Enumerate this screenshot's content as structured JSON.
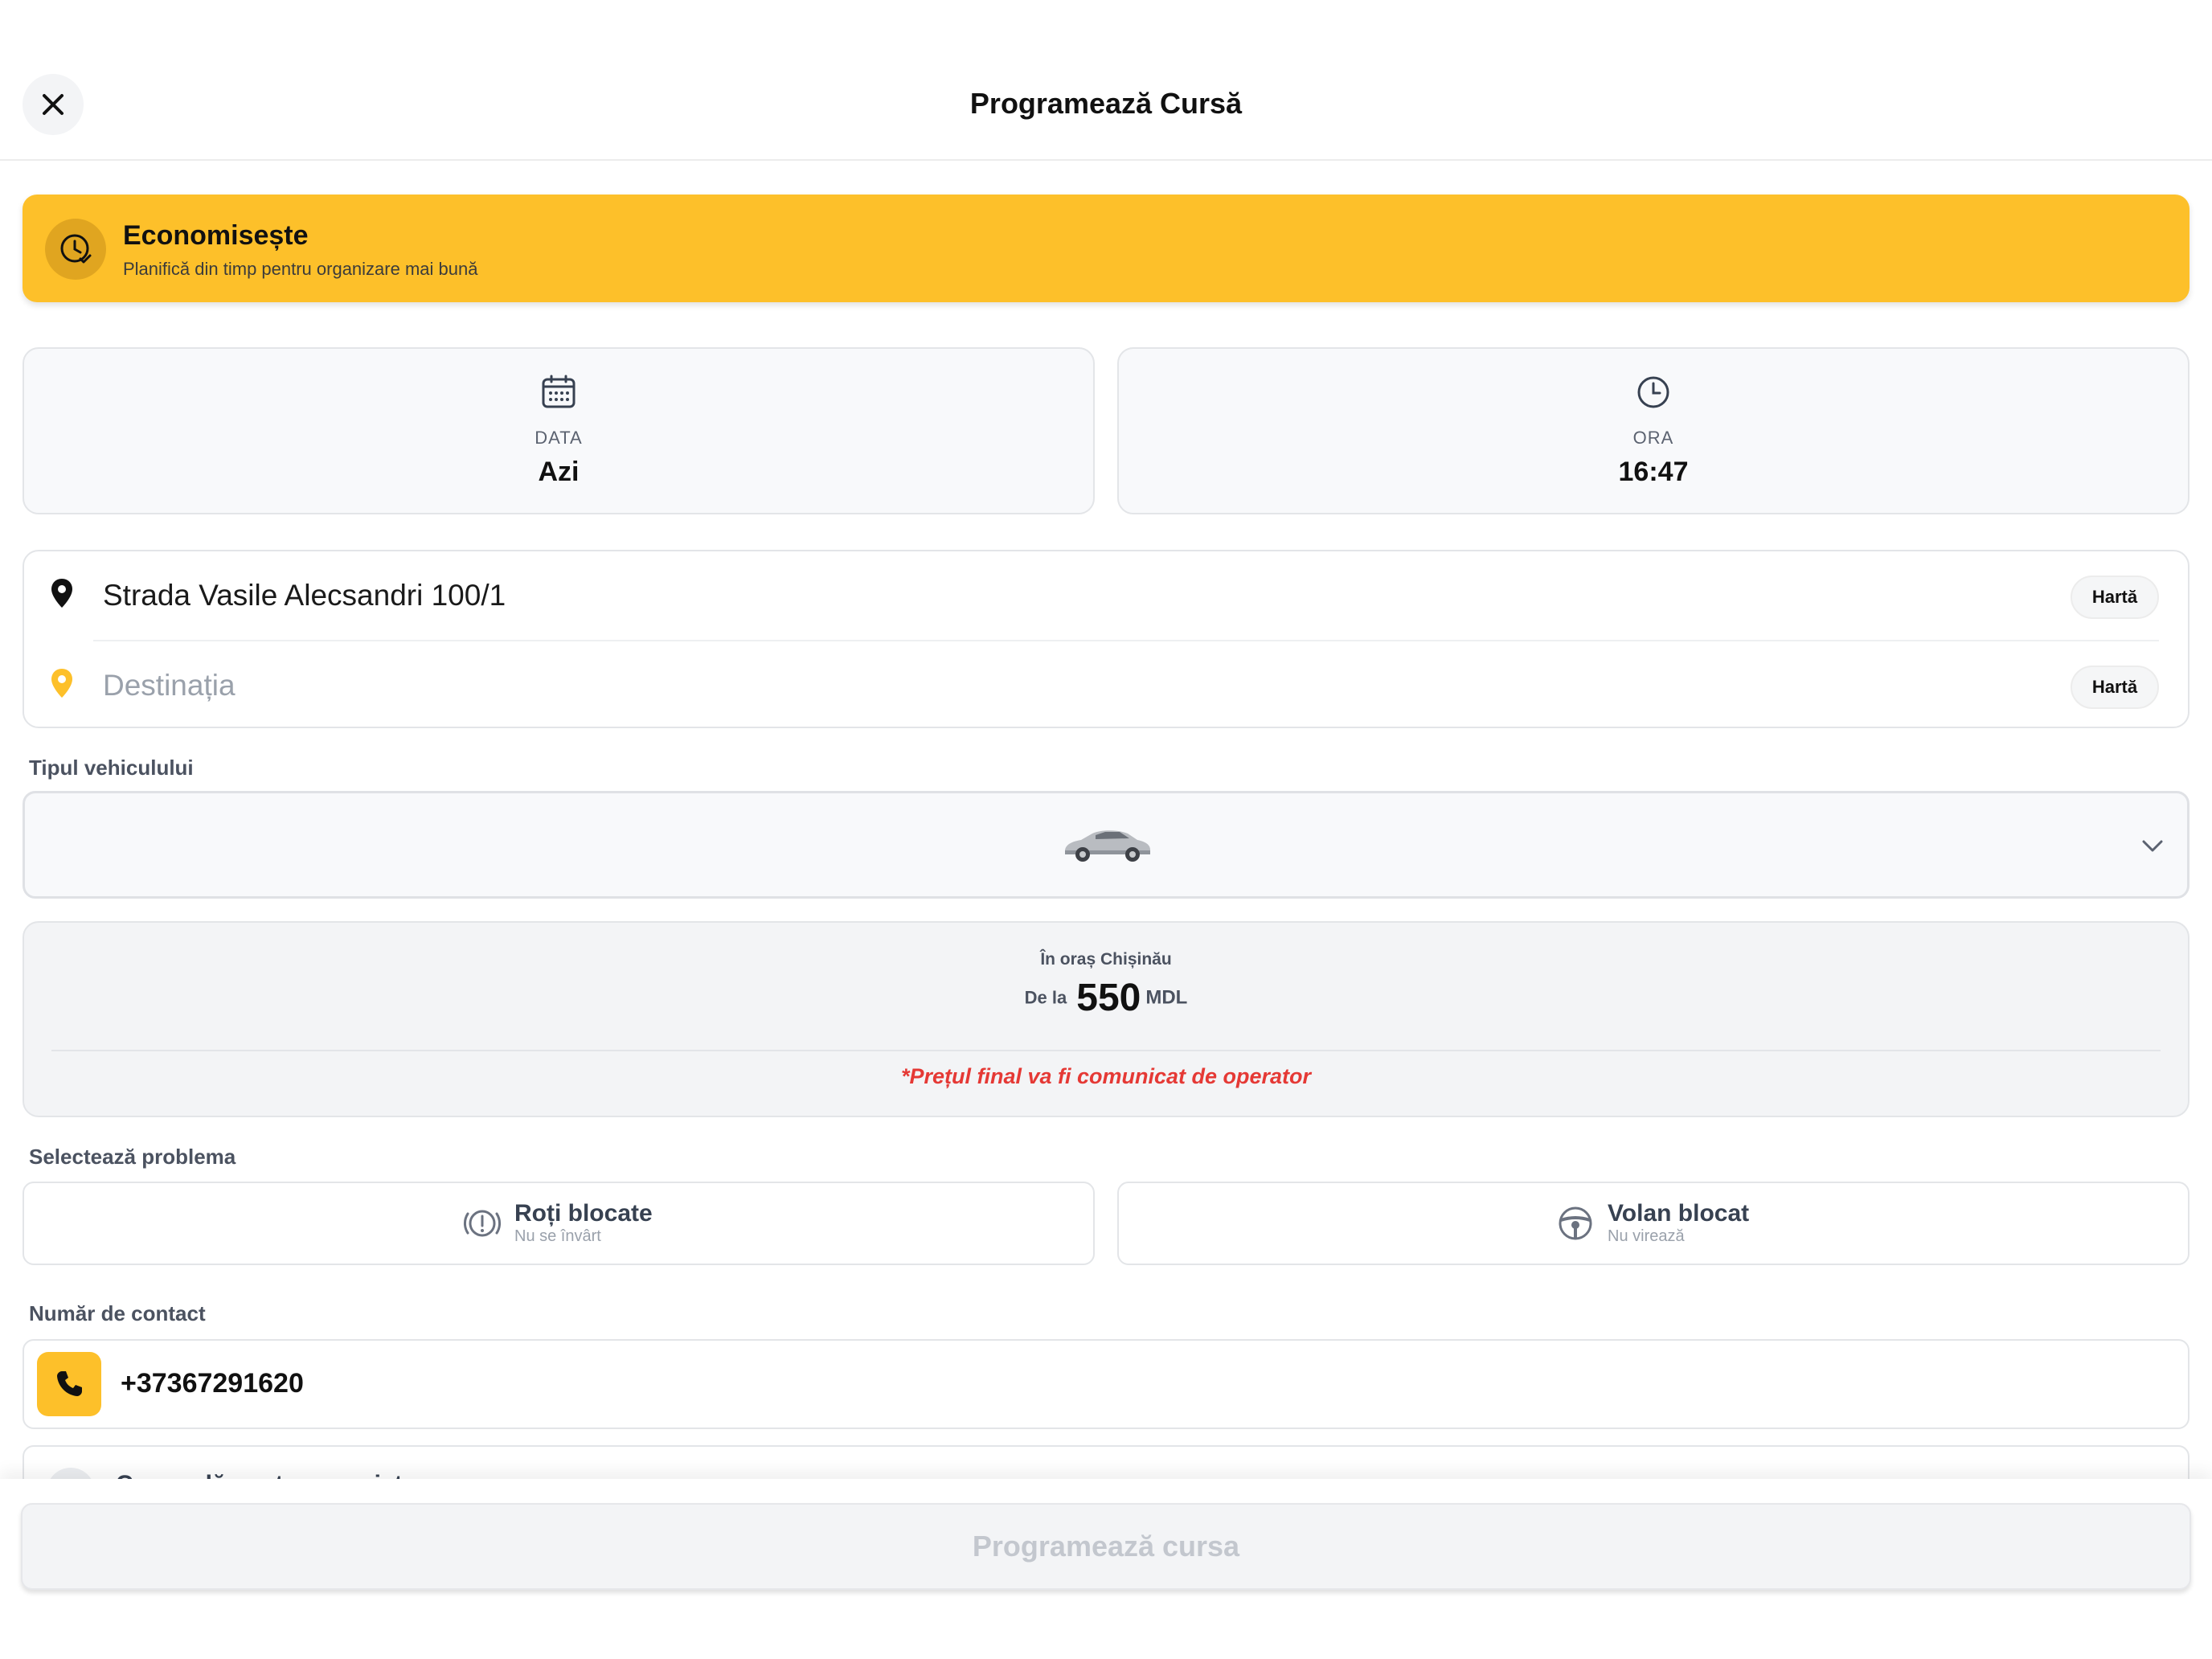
{
  "header": {
    "title": "Programează Cursă",
    "close_icon": "close-icon"
  },
  "promo": {
    "title": "Economisește",
    "subtitle": "Planifică din timp pentru organizare mai bună",
    "icon": "clock-check-icon",
    "color": "#fdc02a"
  },
  "schedule": {
    "date": {
      "label": "DATA",
      "value": "Azi",
      "icon": "calendar-icon"
    },
    "time": {
      "label": "ORA",
      "value": "16:47",
      "icon": "clock-icon"
    }
  },
  "route": {
    "pickup": {
      "value": "Strada Vasile Alecsandri 100/1",
      "icon": "location-pin-icon",
      "map_label": "Hartă"
    },
    "destination": {
      "placeholder": "Destinația",
      "icon": "location-pin-icon",
      "map_label": "Hartă"
    }
  },
  "vehicle": {
    "label": "Tipul vehiculului",
    "icon": "car-icon"
  },
  "price": {
    "city": "În oraș Chișinău",
    "prefix": "De la",
    "amount": "550",
    "currency": "MDL",
    "note": "*Prețul final va fi comunicat de operator",
    "note_color": "#e53935"
  },
  "problem": {
    "label": "Selectează problema",
    "options": [
      {
        "title": "Roți blocate",
        "subtitle": "Nu se învârt",
        "icon": "alert-circle-icon"
      },
      {
        "title": "Volan blocat",
        "subtitle": "Nu virează",
        "icon": "steering-wheel-icon"
      }
    ]
  },
  "contact": {
    "label": "Număr de contact",
    "phone": "+37367291620",
    "icon": "phone-icon"
  },
  "friend": {
    "label": "Comandă pentru un prieten"
  },
  "submit": {
    "label": "Programează cursa"
  }
}
